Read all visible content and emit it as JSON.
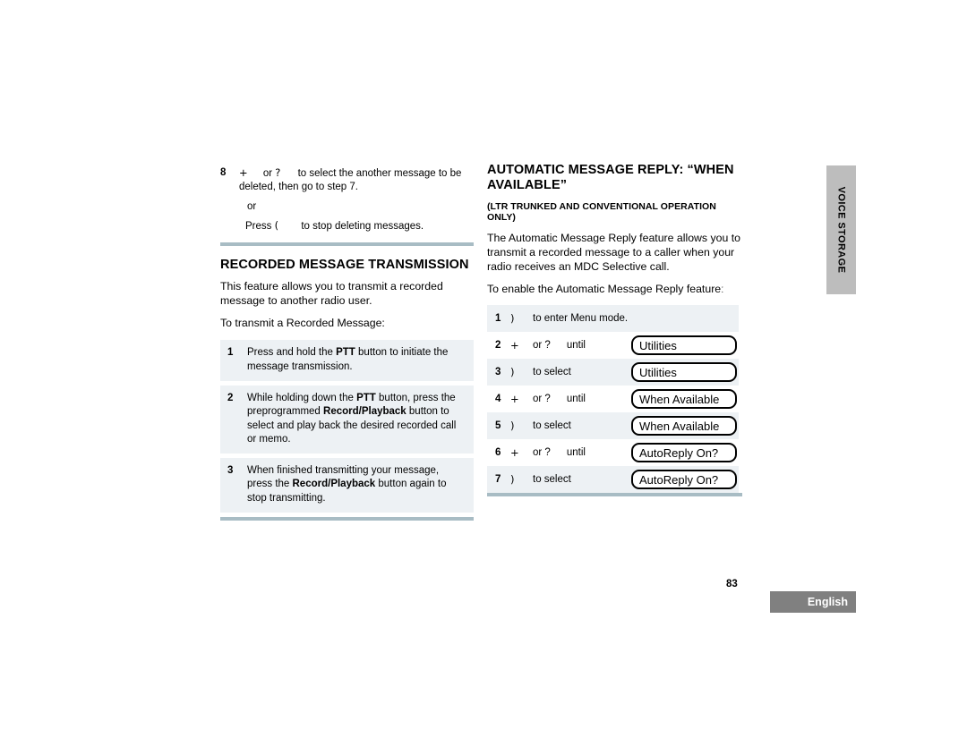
{
  "left_column": {
    "continued_step": {
      "number": "8",
      "key_symbol": "+",
      "or_label": "or",
      "key_symbol_2": "?",
      "text": "to select the another message to be deleted, then go to step 7."
    },
    "or_line": "or",
    "press_line_prefix": "Press",
    "press_line_symbol": "(",
    "press_line_text": "to stop deleting messages.",
    "section_title": "RECORDED MESSAGE TRANSMISSION",
    "intro_paragraph": "This feature allows you to transmit a recorded message to another radio user.",
    "lead_in": "To transmit a Recorded Message:",
    "steps": [
      {
        "number": "1",
        "parts": [
          {
            "text": "Press and hold the ",
            "bold": false
          },
          {
            "text": "PTT",
            "bold": true
          },
          {
            "text": " button to initiate the message transmission.",
            "bold": false
          }
        ]
      },
      {
        "number": "2",
        "parts": [
          {
            "text": "While holding down the ",
            "bold": false
          },
          {
            "text": "PTT",
            "bold": true
          },
          {
            "text": " button, press the preprogrammed ",
            "bold": false
          },
          {
            "text": "Record/Playback",
            "bold": true
          },
          {
            "text": " button to select and play back the desired recorded call or memo.",
            "bold": false
          }
        ]
      },
      {
        "number": "3",
        "parts": [
          {
            "text": "When finished transmitting your message, press the ",
            "bold": false
          },
          {
            "text": "Record/Playback",
            "bold": true
          },
          {
            "text": " button again to stop transmitting.",
            "bold": false
          }
        ]
      }
    ]
  },
  "right_column": {
    "section_title": "AUTOMATIC MESSAGE REPLY: “WHEN AVAILABLE”",
    "sub_title": "(LTR TRUNKED AND CONVENTIONAL OPERATION ONLY)",
    "paragraph_1": "The Automatic Message Reply feature allows you to transmit a recorded message to a caller when your radio receives an MDC Selective call.",
    "paragraph_2": "To enable the Automatic Message Reply featureː",
    "menu_steps": [
      {
        "number": "1",
        "key": ")",
        "action": "to enter Menu mode.",
        "until": "",
        "display": ""
      },
      {
        "number": "2",
        "key": "+",
        "action": "or ?",
        "until": "until",
        "display": "Utilities"
      },
      {
        "number": "3",
        "key": ")",
        "action": "to select",
        "until": "",
        "display": "Utilities"
      },
      {
        "number": "4",
        "key": "+",
        "action": "or ?",
        "until": "until",
        "display": "When Available"
      },
      {
        "number": "5",
        "key": ")",
        "action": "to select",
        "until": "",
        "display": "When Available"
      },
      {
        "number": "6",
        "key": "+",
        "action": "or ?",
        "until": "until",
        "display": "AutoReply On?"
      },
      {
        "number": "7",
        "key": ")",
        "action": "to select",
        "until": "",
        "display": "AutoReply On?"
      }
    ]
  },
  "side_tab": {
    "label": "VOICE STORAGE"
  },
  "footer": {
    "page_number": "83",
    "language": "English"
  },
  "colors": {
    "rule": "#a8bcc4",
    "step_shade": "#edf1f4",
    "side_tab": "#bdbdbd",
    "lang_badge": "#808080"
  }
}
